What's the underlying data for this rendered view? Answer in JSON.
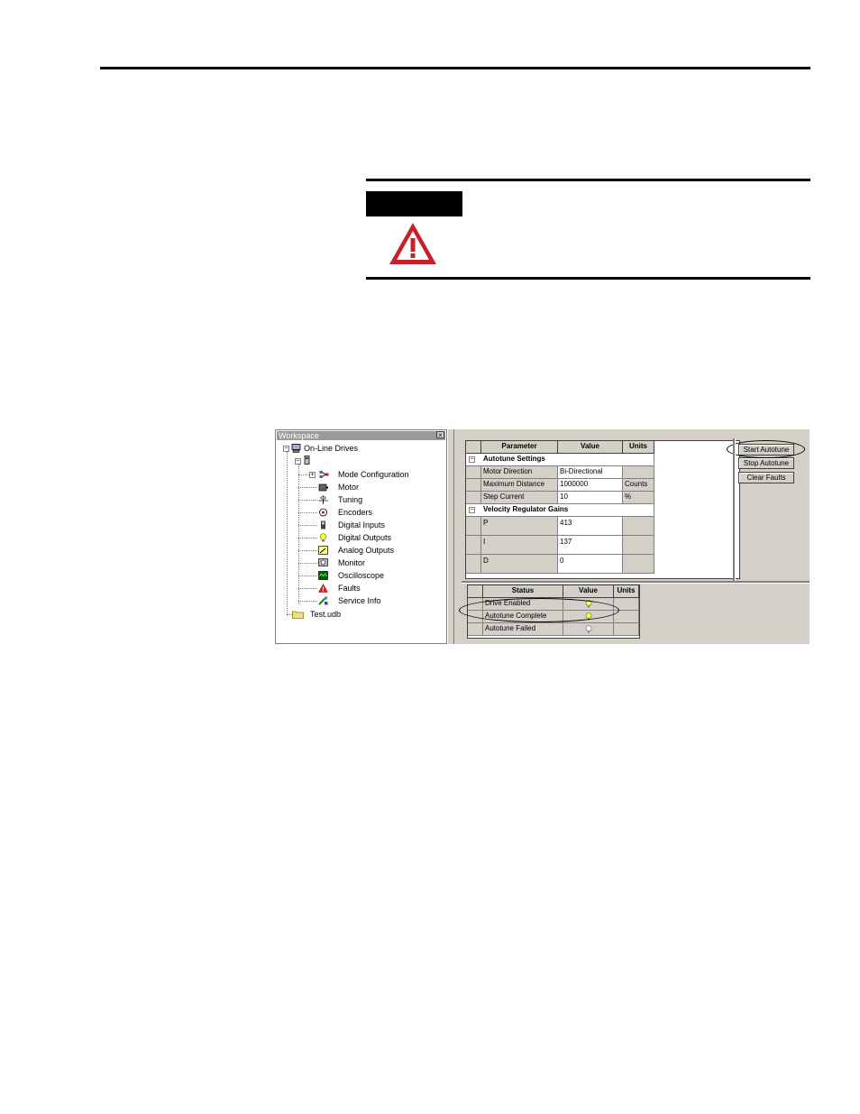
{
  "workspace": {
    "title": "Workspace",
    "close": "×",
    "tree": {
      "root": "On-Line Drives",
      "items": [
        {
          "label": "Mode Configuration",
          "icon": "mode-config-icon"
        },
        {
          "label": "Motor",
          "icon": "motor-icon"
        },
        {
          "label": "Tuning",
          "icon": "tuning-icon"
        },
        {
          "label": "Encoders",
          "icon": "encoder-icon"
        },
        {
          "label": "Digital Inputs",
          "icon": "digital-input-icon"
        },
        {
          "label": "Digital Outputs",
          "icon": "digital-output-icon"
        },
        {
          "label": "Analog Outputs",
          "icon": "analog-output-icon"
        },
        {
          "label": "Monitor",
          "icon": "monitor-icon"
        },
        {
          "label": "Oscilloscope",
          "icon": "oscilloscope-icon"
        },
        {
          "label": "Faults",
          "icon": "fault-warning-icon"
        },
        {
          "label": "Service Info",
          "icon": "service-info-icon"
        }
      ],
      "file": "Test.udb"
    }
  },
  "params": {
    "headers": {
      "parameter": "Parameter",
      "value": "Value",
      "units": "Units"
    },
    "section1": "Autotune Settings",
    "rows1": [
      {
        "name": "Motor Direction",
        "value": "Bi-Directional",
        "units": ""
      },
      {
        "name": "Maximum Distance",
        "value": "1000000",
        "units": "Counts"
      },
      {
        "name": "Step Current",
        "value": "10",
        "units": "%"
      }
    ],
    "section2": "Velocity Regulator Gains",
    "rows2": [
      {
        "name": "P",
        "value": "413",
        "units": ""
      },
      {
        "name": "I",
        "value": "137",
        "units": ""
      },
      {
        "name": "D",
        "value": "0",
        "units": ""
      }
    ]
  },
  "buttons": {
    "start": "Start Autotune",
    "stop": "Stop Autotune",
    "clear": "Clear Faults"
  },
  "status": {
    "headers": {
      "status": "Status",
      "value": "Value",
      "units": "Units"
    },
    "rows": [
      {
        "name": "Drive Enabled",
        "value_state": "on"
      },
      {
        "name": "Autotune Complete",
        "value_state": "on"
      },
      {
        "name": "Autotune Failed",
        "value_state": "off"
      }
    ]
  },
  "colors": {
    "warning_red": "#c8202a",
    "bulb_on": "#ffff40",
    "bulb_off": "#ffffff"
  }
}
